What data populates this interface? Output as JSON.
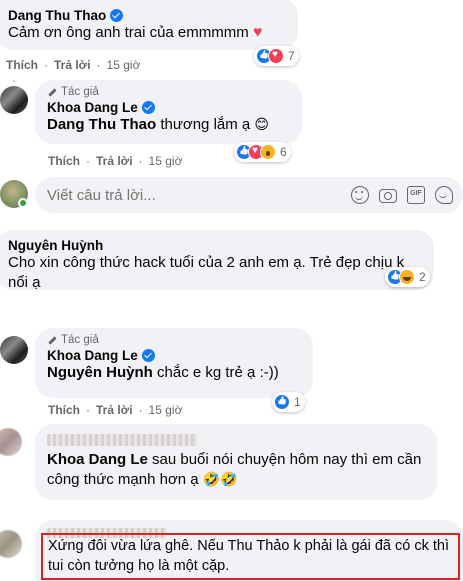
{
  "comments": {
    "c1": {
      "author": "Dang Thu Thao",
      "text": "Cảm ơn ông anh trai của emmmmm",
      "emoji": "♥",
      "reaction_count": "7",
      "like": "Thích",
      "reply": "Trả lời",
      "time": "15 giờ"
    },
    "r1": {
      "author_tag": "Tác giả",
      "author": "Khoa Dang Le",
      "mention": "Dang Thu Thao",
      "text": " thương lắm ạ ",
      "emoji": "😊",
      "reaction_count": "6",
      "like": "Thích",
      "reply": "Trả lời",
      "time": "15 giờ"
    },
    "reply_input": {
      "placeholder": "Viết câu trả lời...",
      "gif_label": "GIF"
    },
    "c2": {
      "author": "Nguyên Huỳnh",
      "text": "Cho xin công thức hack tuổi của 2 anh em ạ. Trẻ đẹp chịu k nổi ạ",
      "reaction_count": "2"
    },
    "r2": {
      "author_tag": "Tác giả",
      "author": "Khoa Dang Le",
      "mention": "Nguyên Huỳnh",
      "text": " chắc e kg trẻ ạ :-))",
      "reaction_count": "1",
      "like": "Thích",
      "reply": "Trả lời",
      "time": "15 giờ"
    },
    "c3": {
      "mention": "Khoa Dang Le",
      "text": " sau buổi nói chuyện hôm nay thì em cần công thức mạnh hơn ạ ",
      "emoji": "🤣🤣"
    },
    "c4": {
      "text": "Xứng đôi vừa lứa ghê. Nếu Thu Thảo k phải là gái đã có ck thì tui còn tưởng họ là một cặp."
    }
  },
  "colors": {
    "bubble": "#f0f2f5",
    "meta": "#65676b",
    "verified": "#1877f2",
    "highlight": "#e41e26"
  }
}
